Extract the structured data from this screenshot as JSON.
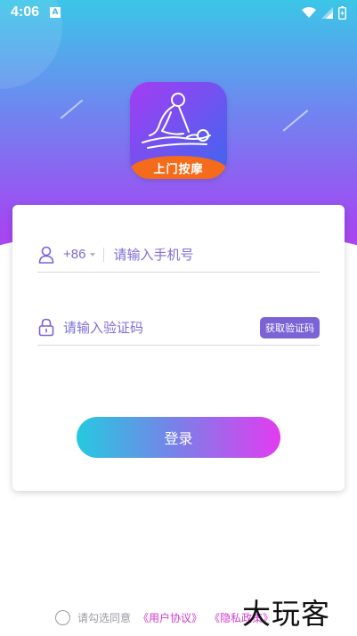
{
  "status_bar": {
    "time": "4:06",
    "notification_badge": "A",
    "icons": [
      "wifi-icon",
      "signal-icon",
      "battery-icon"
    ]
  },
  "app": {
    "logo_text": "上门按摩",
    "colors": {
      "gradient_top": "#3cc6e8",
      "gradient_bottom": "#b63ff0",
      "accent_purple": "#7b63d6",
      "link_magenta": "#d23ad3",
      "logo_band": "#f36b1b"
    }
  },
  "form": {
    "country_code": "+86",
    "phone_placeholder": "请输入手机号",
    "phone_value": "",
    "code_placeholder": "请输入验证码",
    "code_value": "",
    "get_code_label": "获取验证码",
    "login_label": "登录"
  },
  "agreement": {
    "prefix": "请勾选同意",
    "user_agreement": "《用户协议》",
    "privacy_policy": "《隐私政策》",
    "checked": false
  },
  "watermark": "大玩客"
}
